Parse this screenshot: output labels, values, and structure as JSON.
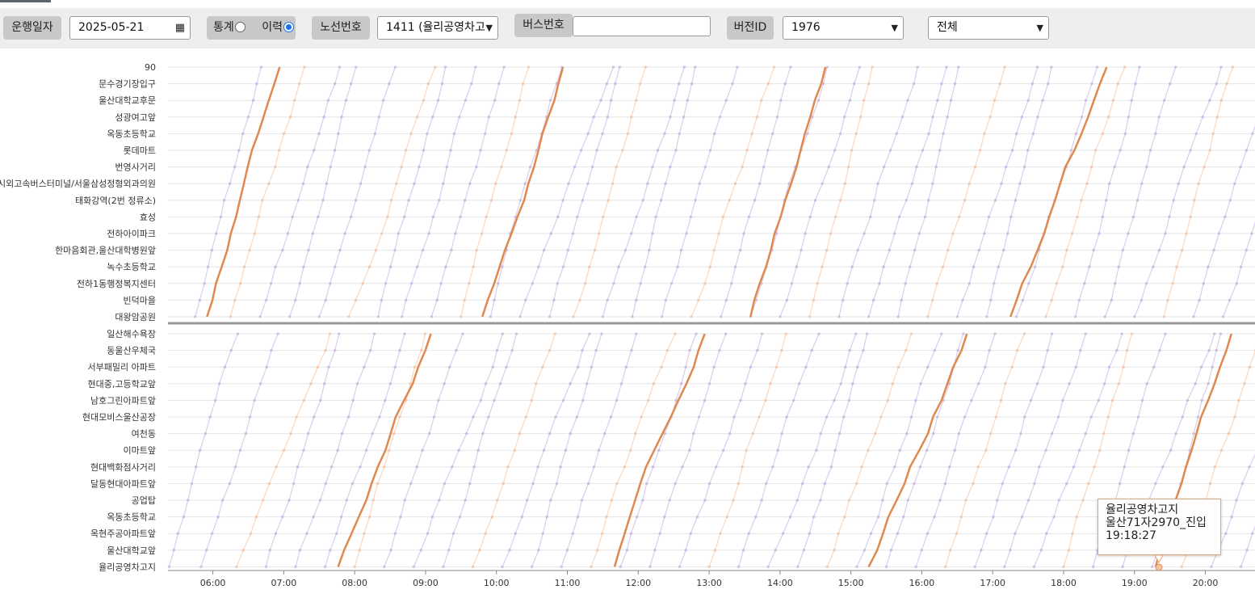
{
  "toolbar": {
    "date_label": "운행일자",
    "date_value": "2025-05-21",
    "mode_stats_label": "통계",
    "mode_history_label": "이력",
    "mode_selected": "이력",
    "route_label": "노선번호",
    "route_value": "1411 (율리공영차고",
    "bus_label": "버스번호",
    "bus_value": "",
    "version_label": "버전ID",
    "version_value": "1976",
    "filter_value": "전체"
  },
  "chart_data": {
    "type": "line",
    "y_categories_top": [
      "90",
      "문수경기장입구",
      "울산대학교후문",
      "성광여고앞",
      "옥동초등학교",
      "롯데마트",
      "번영사거리",
      "시외고속버스터미널/서울삼성정형외과의원",
      "태화강역(2번 정류소)",
      "효성",
      "전하아이파크",
      "한마음회관,울산대학병원앞",
      "녹수초등학교",
      "전하1동행정복지센터",
      "빈덕마을",
      "대왕암공원"
    ],
    "y_categories_bottom": [
      "일산해수욕장",
      "동울산우체국",
      "서부패밀리 아파트",
      "현대중,고등학교앞",
      "남호그린아파트앞",
      "현대모비스울산공장",
      "여천동",
      "이마트앞",
      "현대백화점사거리",
      "달동현대아파트앞",
      "공업탑",
      "옥동초등학교",
      "옥현주공아파트앞",
      "울산대학교앞",
      "율리공영차고지"
    ],
    "x_ticks": [
      "06:00",
      "07:00",
      "08:00",
      "09:00",
      "10:00",
      "11:00",
      "12:00",
      "13:00",
      "14:00",
      "15:00",
      "16:00",
      "17:00",
      "18:00",
      "19:00",
      "20:00"
    ],
    "x_range": [
      "05:22",
      "20:42"
    ],
    "grid": true,
    "background_series_color": "#b9a6dc",
    "highlight_color": "#e0894e",
    "bus_trips_outbound_start": [
      "05:45",
      "06:15",
      "06:40",
      "07:05",
      "07:30",
      "07:55",
      "08:20",
      "08:40",
      "09:05",
      "09:30",
      "09:55",
      "10:20",
      "10:45",
      "11:05",
      "11:30",
      "11:55",
      "12:20",
      "12:45",
      "13:10",
      "13:35",
      "14:00",
      "14:25",
      "14:50",
      "15:15",
      "15:40",
      "16:05",
      "16:30",
      "16:55",
      "17:20",
      "17:45",
      "18:10",
      "18:35",
      "19:00",
      "19:25",
      "19:50",
      "20:15"
    ],
    "bus_trips_return_start": [
      "05:23",
      "05:50",
      "06:20",
      "06:45",
      "07:10",
      "07:35",
      "08:00",
      "08:25",
      "08:50",
      "09:15",
      "09:40",
      "10:05",
      "10:30",
      "10:55",
      "11:20",
      "11:45",
      "12:10",
      "12:35",
      "13:00",
      "13:25",
      "13:50",
      "14:15",
      "14:40",
      "15:05",
      "15:30",
      "15:55",
      "16:20",
      "16:45",
      "17:10",
      "17:35",
      "18:00",
      "18:25",
      "18:50",
      "19:15",
      "19:40",
      "20:05",
      "20:30"
    ],
    "highlighted_bus": {
      "plate": "울산71자2970",
      "outbound_trips": [
        {
          "start": "05:55",
          "end": "06:57"
        },
        {
          "start": "09:48",
          "end": "10:54"
        },
        {
          "start": "13:35",
          "end": "14:40"
        },
        {
          "start": "17:15",
          "end": "18:45"
        }
      ],
      "return_trips": [
        {
          "start": "07:46",
          "end": "09:07"
        },
        {
          "start": "11:40",
          "end": "12:57"
        },
        {
          "start": "15:15",
          "end": "16:40"
        },
        {
          "start": "19:18",
          "end": "20:25"
        }
      ]
    }
  },
  "tooltip": {
    "stop": "율리공영차고지",
    "event": "울산71자2970_진입",
    "time": "19:18:27"
  }
}
